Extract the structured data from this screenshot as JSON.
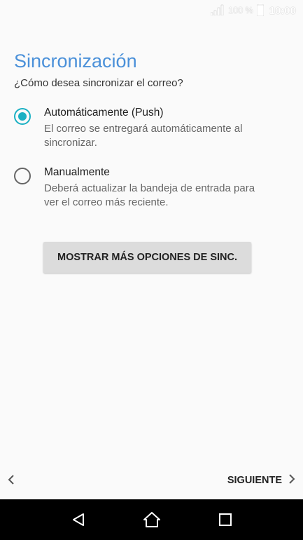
{
  "status_bar": {
    "battery_percent": "100 %",
    "time": "10:00"
  },
  "page": {
    "title": "Sincronización",
    "subtitle": "¿Cómo desea sincronizar el correo?"
  },
  "options": [
    {
      "label": "Automáticamente (Push)",
      "description_line1": "El correo se entregará automáticamente al",
      "description_line2": "sincronizar.",
      "selected": true
    },
    {
      "label": "Manualmente",
      "description_line1": "Deberá actualizar la bandeja de entrada para",
      "description_line2": "ver el correo más reciente.",
      "selected": false
    }
  ],
  "more_options_button": "MOSTRAR MÁS OPCIONES DE SINC.",
  "navigation": {
    "next_label": "SIGUIENTE"
  },
  "icons": {
    "signal": "signal-icon",
    "battery": "battery-icon",
    "back": "chevron-left-icon",
    "next": "chevron-right-icon",
    "nav_back": "triangle-back-icon",
    "nav_home": "home-icon",
    "nav_recents": "square-recents-icon"
  },
  "colors": {
    "accent": "#1ab0c3",
    "title": "#4a90d9"
  }
}
